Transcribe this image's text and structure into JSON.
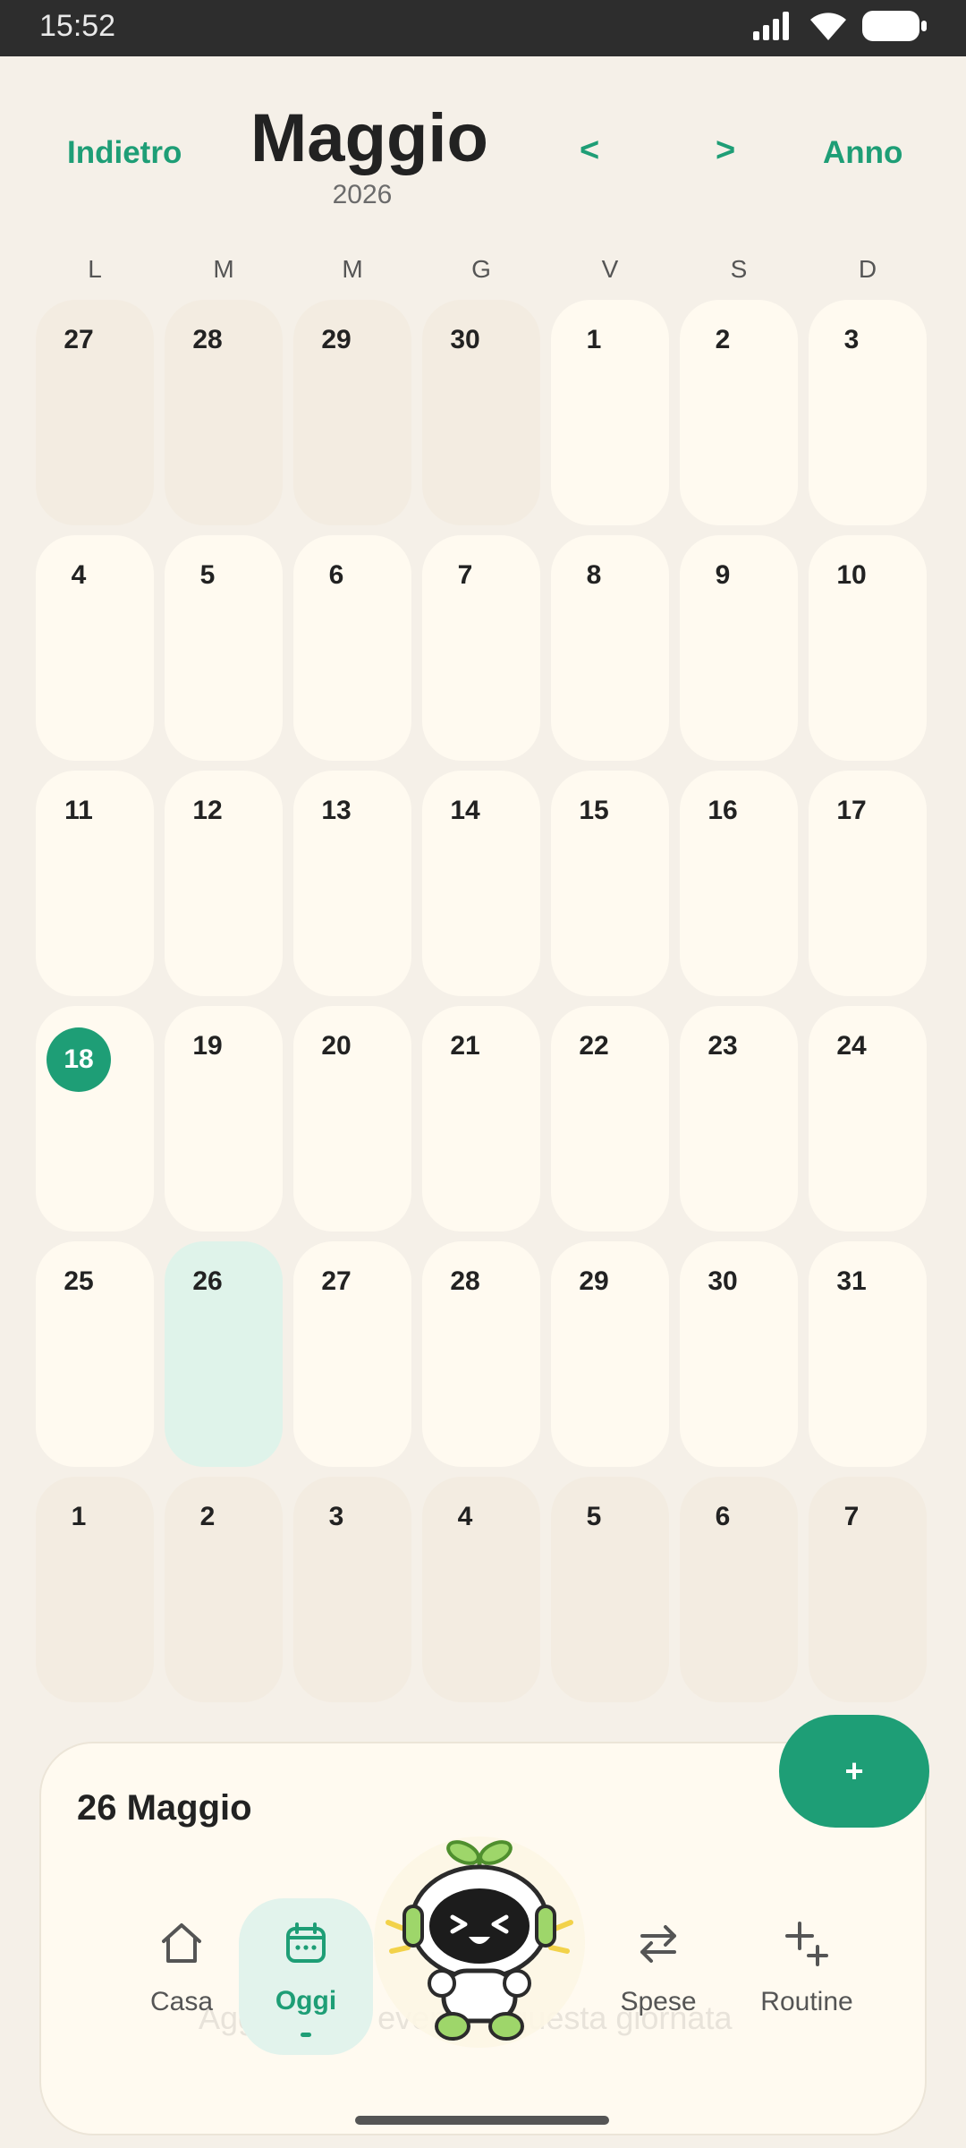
{
  "status_bar": {
    "time": "15:52"
  },
  "header": {
    "back_label": "Indietro",
    "month": "Maggio",
    "year": "2026",
    "prev_label": "<",
    "next_label": ">",
    "year_view_label": "Anno"
  },
  "weekdays": [
    "L",
    "M",
    "M",
    "G",
    "V",
    "S",
    "D"
  ],
  "calendar": {
    "today": "18",
    "selected": "26",
    "rows": [
      [
        {
          "d": "27",
          "other": true
        },
        {
          "d": "28",
          "other": true
        },
        {
          "d": "29",
          "other": true
        },
        {
          "d": "30",
          "other": true
        },
        {
          "d": "1"
        },
        {
          "d": "2"
        },
        {
          "d": "3"
        }
      ],
      [
        {
          "d": "4"
        },
        {
          "d": "5"
        },
        {
          "d": "6"
        },
        {
          "d": "7"
        },
        {
          "d": "8"
        },
        {
          "d": "9"
        },
        {
          "d": "10"
        }
      ],
      [
        {
          "d": "11"
        },
        {
          "d": "12"
        },
        {
          "d": "13"
        },
        {
          "d": "14"
        },
        {
          "d": "15"
        },
        {
          "d": "16"
        },
        {
          "d": "17"
        }
      ],
      [
        {
          "d": "18",
          "today": true
        },
        {
          "d": "19"
        },
        {
          "d": "20"
        },
        {
          "d": "21"
        },
        {
          "d": "22"
        },
        {
          "d": "23"
        },
        {
          "d": "24"
        }
      ],
      [
        {
          "d": "25"
        },
        {
          "d": "26",
          "selected": true
        },
        {
          "d": "27"
        },
        {
          "d": "28"
        },
        {
          "d": "29"
        },
        {
          "d": "30"
        },
        {
          "d": "31"
        }
      ],
      [
        {
          "d": "1",
          "other": true
        },
        {
          "d": "2",
          "other": true
        },
        {
          "d": "3",
          "other": true
        },
        {
          "d": "4",
          "other": true
        },
        {
          "d": "5",
          "other": true
        },
        {
          "d": "6",
          "other": true
        },
        {
          "d": "7",
          "other": true
        }
      ]
    ]
  },
  "day_panel": {
    "title": "26 Maggio",
    "hint": "Aggiungi un evento a questa giornata"
  },
  "fab": {
    "label": "+"
  },
  "tabbar": {
    "items": [
      {
        "label": "Casa",
        "icon": "home-icon"
      },
      {
        "label": "Oggi",
        "icon": "calendar-icon",
        "active": true
      },
      {
        "label": "Spese",
        "icon": "transfer-icon"
      },
      {
        "label": "Routine",
        "icon": "add-routine-icon"
      }
    ]
  },
  "colors": {
    "accent": "#1e9e76",
    "background": "#f5f0e8",
    "day_cell": "#fffaf0",
    "other_month_cell": "#f3ece1",
    "selected_cell": "#dff3ea"
  }
}
